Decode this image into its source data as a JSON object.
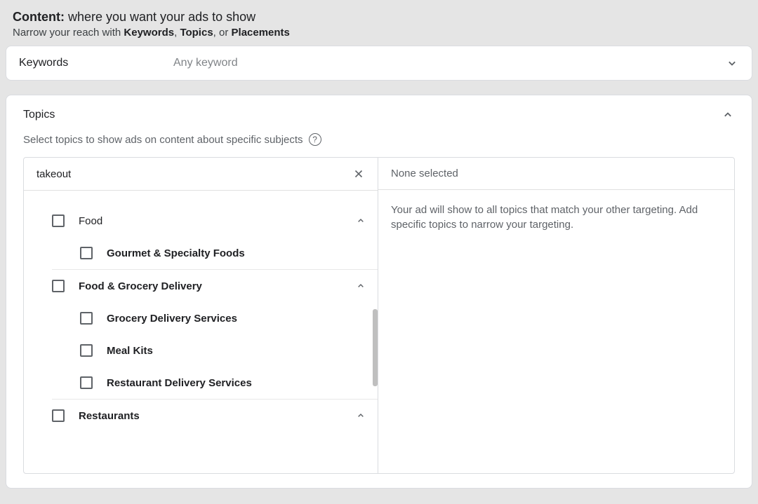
{
  "header": {
    "title_strong": "Content:",
    "title_rest": " where you want your ads to show",
    "subtitle_a": "Narrow your reach with ",
    "subtitle_kw": "Keywords",
    "subtitle_b": ", ",
    "subtitle_tp": "Topics",
    "subtitle_c": ", or ",
    "subtitle_pl": "Placements"
  },
  "keywords": {
    "label": "Keywords",
    "value": "Any keyword"
  },
  "topics": {
    "label": "Topics",
    "desc": "Select topics to show ads on content about specific subjects",
    "search_value": "takeout",
    "selected_head": "None selected",
    "selected_body": "Your ad will show to all topics that match your other targeting. Add specific topics to narrow your targeting.",
    "tree": {
      "food": {
        "label": "Food",
        "bold": false
      },
      "gourmet": {
        "label": "Gourmet & Specialty Foods"
      },
      "fgd": {
        "label": "Food & Grocery Delivery"
      },
      "grocery": {
        "label": "Grocery Delivery Services"
      },
      "mealkits": {
        "label": "Meal Kits"
      },
      "restaurant_delivery": {
        "label": "Restaurant Delivery Services"
      },
      "restaurants": {
        "label": "Restaurants"
      }
    }
  }
}
